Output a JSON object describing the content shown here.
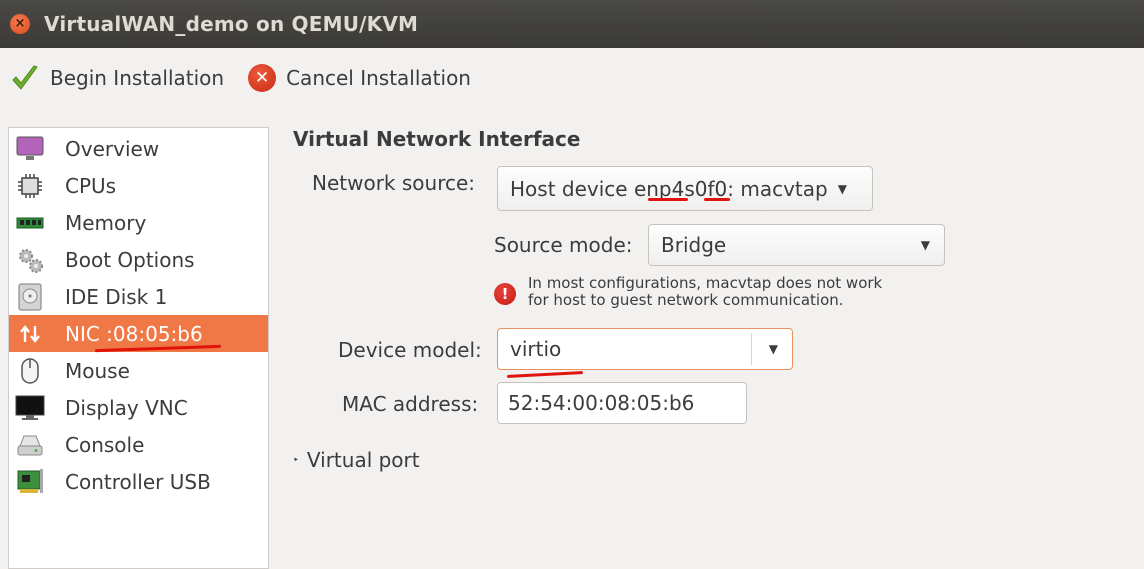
{
  "window": {
    "title": "VirtualWAN_demo on QEMU/KVM",
    "close_glyph": "×"
  },
  "toolbar": {
    "begin_label": "Begin Installation",
    "cancel_label": "Cancel Installation",
    "cancel_glyph": "✕"
  },
  "sidebar": {
    "items": [
      {
        "label": "Overview",
        "icon": "monitor-icon"
      },
      {
        "label": "CPUs",
        "icon": "cpu-chip-icon"
      },
      {
        "label": "Memory",
        "icon": "memory-module-icon"
      },
      {
        "label": "Boot Options",
        "icon": "gears-icon"
      },
      {
        "label": "IDE Disk 1",
        "icon": "hard-disk-icon"
      },
      {
        "label": "NIC :08:05:b6",
        "icon": "network-arrows-icon",
        "selected": true
      },
      {
        "label": "Mouse",
        "icon": "mouse-icon"
      },
      {
        "label": "Display VNC",
        "icon": "display-icon"
      },
      {
        "label": "Console",
        "icon": "console-icon"
      },
      {
        "label": "Controller USB",
        "icon": "pci-card-icon"
      }
    ]
  },
  "main": {
    "section_title": "Virtual Network Interface",
    "network_source": {
      "label": "Network source:",
      "value": "Host device enp4s0f0: macvtap"
    },
    "source_mode": {
      "label": "Source mode:",
      "value": "Bridge"
    },
    "warning": {
      "glyph": "!",
      "line1": "In most configurations, macvtap does not work",
      "line2": "for host to guest network communication."
    },
    "device_model": {
      "label": "Device model:",
      "value": "virtio"
    },
    "mac_address": {
      "label": "MAC address:",
      "value": "52:54:00:08:05:b6"
    },
    "virtual_port": {
      "label": "Virtual port",
      "glyph": "‣"
    }
  },
  "colors": {
    "selection": "#f07746",
    "annotation": "#e0140c",
    "titlebar": "#3c3b37"
  }
}
